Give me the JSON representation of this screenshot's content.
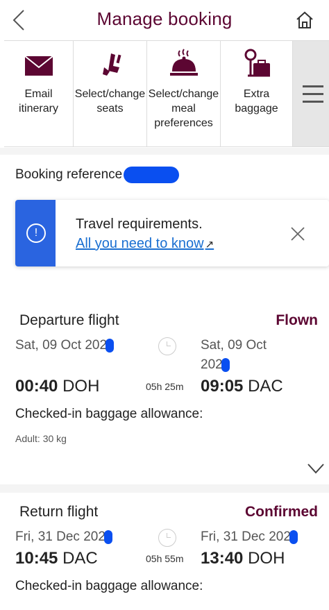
{
  "header": {
    "title": "Manage booking",
    "back_icon": "chevron-left-icon",
    "home_icon": "home-icon"
  },
  "actions": [
    {
      "label": "Email\nitinerary",
      "icon": "envelope-icon"
    },
    {
      "label": "Select/change\nseats",
      "icon": "seat-icon"
    },
    {
      "label": "Select/change\nmeal\npreferences",
      "icon": "meal-cloche-icon"
    },
    {
      "label": "Extra\nbaggage",
      "icon": "baggage-icon"
    }
  ],
  "booking": {
    "reference_label": "Booking reference"
  },
  "requirements": {
    "title": "Travel requirements.",
    "link": "All you need to know",
    "link_arrow": "↗"
  },
  "departure": {
    "type": "Departure flight",
    "status": "Flown",
    "from_date": "Sat, 09 Oct 202",
    "to_date_line1": "Sat, 09 Oct",
    "to_date_line2": "202",
    "from_time": "00:40",
    "from_code": "DOH",
    "duration": "05h 25m",
    "to_time": "09:05",
    "to_code": "DAC",
    "baggage_label": "Checked-in baggage allowance:",
    "baggage_value": "Adult: 30 kg"
  },
  "return": {
    "type": "Return flight",
    "status": "Confirmed",
    "from_date": "Fri, 31 Dec 202",
    "to_date": "Fri, 31 Dec 202",
    "from_time": "10:45",
    "from_code": "DAC",
    "duration": "05h 55m",
    "to_time": "13:40",
    "to_code": "DOH",
    "baggage_label": "Checked-in baggage allowance:"
  },
  "colors": {
    "brand": "#5c0632",
    "link": "#1a6fd1",
    "info_band": "#2a64e0"
  }
}
